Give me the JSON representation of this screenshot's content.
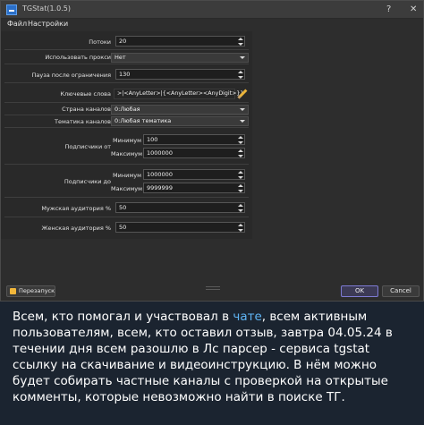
{
  "window": {
    "title": "TGStat(1.0.5)",
    "help_glyph": "?",
    "close_glyph": "✕"
  },
  "menu": {
    "file": "Файл",
    "settings": "Настройки"
  },
  "form": {
    "threads": {
      "label": "Потоки",
      "value": "20"
    },
    "use_proxy": {
      "label": "Использовать прокси",
      "value": "Нет"
    },
    "pause": {
      "label": "Пауза после ограничения",
      "value": "130"
    },
    "keywords": {
      "label": "Ключевые слова",
      "value": ">|<AnyLetter>|{<AnyLetter><AnyDigit>}}"
    },
    "country": {
      "label": "Страна каналов",
      "value": "0:Любая"
    },
    "topic": {
      "label": "Тематика каналов",
      "value": "0:Любая тематика"
    },
    "subs_from": {
      "label": "Подписчики от",
      "min_label": "Минимум",
      "min_value": "100",
      "max_label": "Максимум",
      "max_value": "1000000"
    },
    "subs_to": {
      "label": "Подписчики до",
      "min_label": "Минимум",
      "min_value": "1000000",
      "max_label": "Максимум",
      "max_value": "9999999"
    },
    "male": {
      "label": "Мужская аудитория %",
      "value": "50"
    },
    "female": {
      "label": "Женская аудитория %",
      "value": "50"
    }
  },
  "buttons": {
    "restart": "Перезапуск",
    "ok": "OK",
    "cancel": "Cancel"
  },
  "message": {
    "part1": "Всем, кто помогал и участвовал в ",
    "link": "чате",
    "part2": ", всем активным пользователям, всем, кто оставил отзыв, завтра 04.05.24 в течении дня всем разошлю в Лс парсер - сервиса tgstat ссылку на скачивание и видеоинструкцию. В нём можно будет собирать частные каналы с проверкой на открытые комменты, которые невозможно найти в поиске ТГ."
  },
  "colors": {
    "accent": "#7e7bd4",
    "link": "#5fb5f5",
    "chat_background": "#1b2430"
  }
}
